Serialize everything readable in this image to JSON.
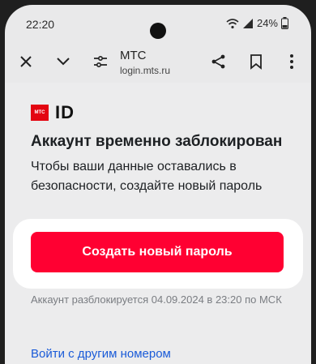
{
  "status_bar": {
    "time": "22:20",
    "battery": "24%"
  },
  "browser": {
    "site_name": "МТС",
    "site_url": "login.mts.ru",
    "icons": [
      "close-icon",
      "chevron-down-icon",
      "site-settings-icon",
      "share-icon",
      "bookmark-icon",
      "more-vert-icon"
    ]
  },
  "page": {
    "logo_mark": "МТС",
    "logo_text": "ID",
    "title": "Аккаунт временно заблокирован",
    "description": "Чтобы ваши данные оставались в безопасности, создайте новый пароль",
    "primary_button": "Создать новый пароль",
    "unlock_note": "Аккаунт разблокируется 04.09.2024 в 23:20 по МСК",
    "other_number_link": "Войти с другим номером"
  },
  "colors": {
    "brand_red": "#ff0032",
    "logo_red": "#e30611",
    "link_blue": "#1a5bd8"
  }
}
